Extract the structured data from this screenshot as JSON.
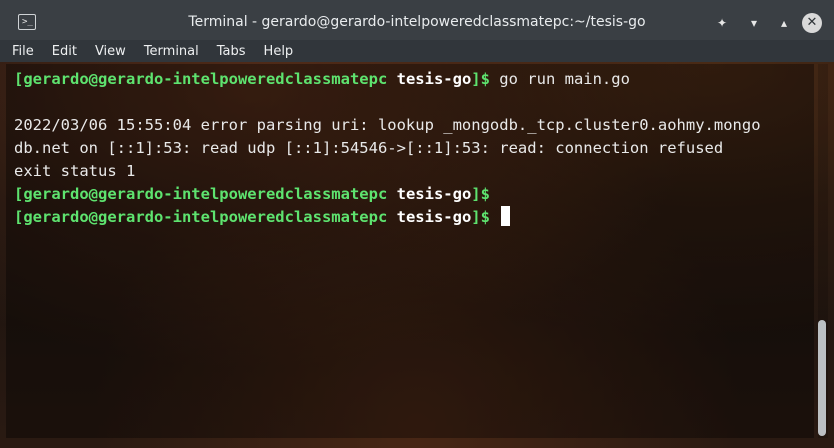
{
  "window": {
    "title": "Terminal - gerardo@gerardo-intelpoweredclassmatepc:~/tesis-go",
    "icon": "terminal-icon"
  },
  "controls": {
    "pin_icon": "pin-icon",
    "minimize_icon": "minimize-icon",
    "maximize_icon": "maximize-icon",
    "close_icon": "close-icon"
  },
  "menu": {
    "items": [
      "File",
      "Edit",
      "View",
      "Terminal",
      "Tabs",
      "Help"
    ]
  },
  "terminal": {
    "prompt_user": "[gerardo@gerardo-intelpoweredclassmatepc",
    "prompt_dir": "tesis-go",
    "prompt_end": "]$",
    "command": " go run main.go",
    "output": [
      "2022/03/06 15:55:04 error parsing uri: lookup _mongodb._tcp.cluster0.aohmy.mongo",
      "db.net on [::1]:53: read udp [::1]:54546->[::1]:53: read: connection refused",
      "exit status 1"
    ]
  },
  "colors": {
    "prompt_user": "#5ee36f",
    "text": "#e9e9e9",
    "titlebar": "#3a3f44"
  }
}
